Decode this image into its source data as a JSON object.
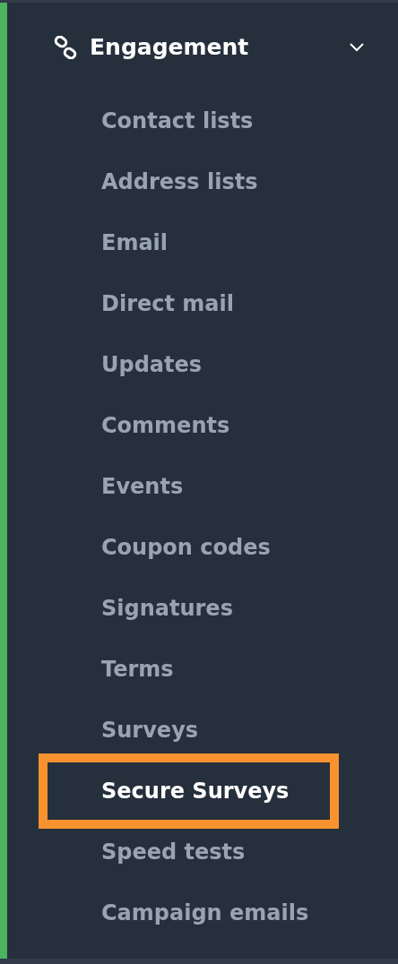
{
  "section": {
    "title": "Engagement",
    "expanded": true
  },
  "items": [
    {
      "label": "Contact lists",
      "selected": false,
      "highlighted": false
    },
    {
      "label": "Address lists",
      "selected": false,
      "highlighted": false
    },
    {
      "label": "Email",
      "selected": false,
      "highlighted": false
    },
    {
      "label": "Direct mail",
      "selected": false,
      "highlighted": false
    },
    {
      "label": "Updates",
      "selected": false,
      "highlighted": false
    },
    {
      "label": "Comments",
      "selected": false,
      "highlighted": false
    },
    {
      "label": "Events",
      "selected": false,
      "highlighted": false
    },
    {
      "label": "Coupon codes",
      "selected": false,
      "highlighted": false
    },
    {
      "label": "Signatures",
      "selected": false,
      "highlighted": false
    },
    {
      "label": "Terms",
      "selected": false,
      "highlighted": false
    },
    {
      "label": "Surveys",
      "selected": false,
      "highlighted": false
    },
    {
      "label": "Secure Surveys",
      "selected": true,
      "highlighted": true
    },
    {
      "label": "Speed tests",
      "selected": false,
      "highlighted": false
    },
    {
      "label": "Campaign emails",
      "selected": false,
      "highlighted": false
    }
  ]
}
